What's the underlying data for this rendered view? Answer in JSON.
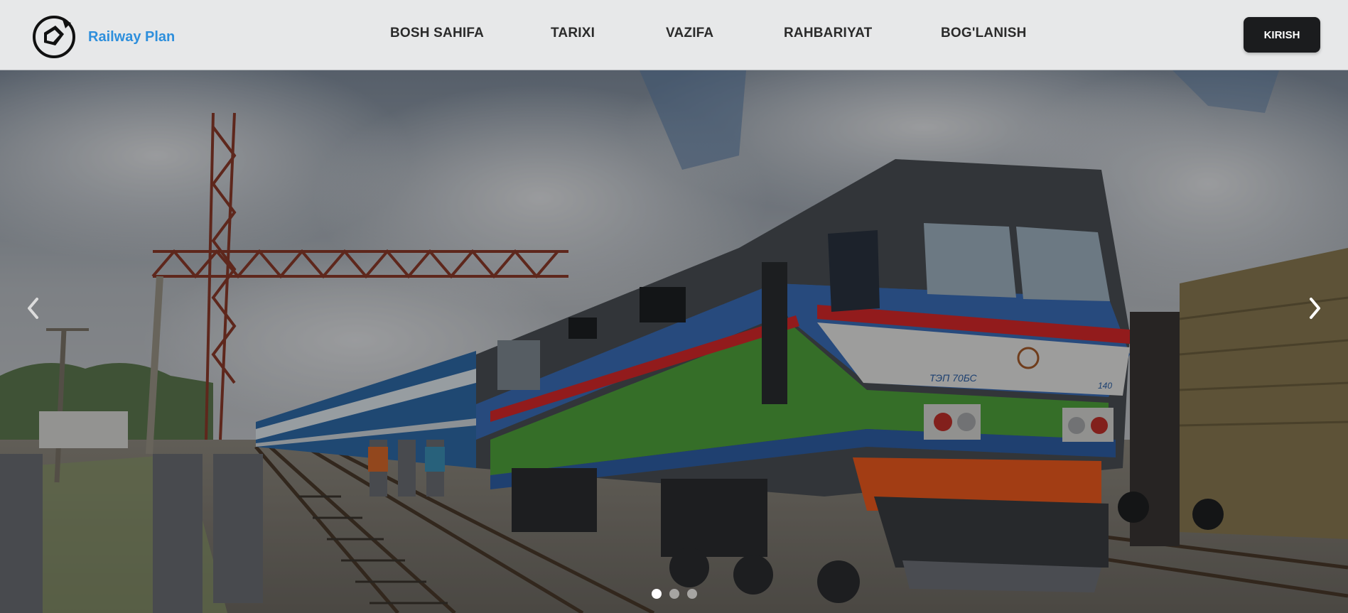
{
  "brand": {
    "name": "Railway Plan",
    "color": "#2e8fdc"
  },
  "nav": {
    "items": [
      {
        "label": "BOSH SAHIFA"
      },
      {
        "label": "TARIXI"
      },
      {
        "label": "VAZIFA"
      },
      {
        "label": "RAHBARIYAT"
      },
      {
        "label": "BOG'LANISH"
      }
    ]
  },
  "header": {
    "login_label": "KIRISH"
  },
  "carousel": {
    "slide_count": 3,
    "active_slide": 1,
    "image_subject": "passenger locomotive at railway station",
    "locomotive_marking": "ТЭП 70БС",
    "locomotive_number": "140",
    "icons": {
      "prev": "chevron-left-icon",
      "next": "chevron-right-icon"
    }
  },
  "colors": {
    "header_bg": "#e7e8e9",
    "button_bg": "#1b1c1e",
    "loco_blue": "#3a6db8",
    "loco_green": "#4fa23b",
    "loco_red": "#d8292a",
    "loco_orange": "#ef5a1e"
  }
}
